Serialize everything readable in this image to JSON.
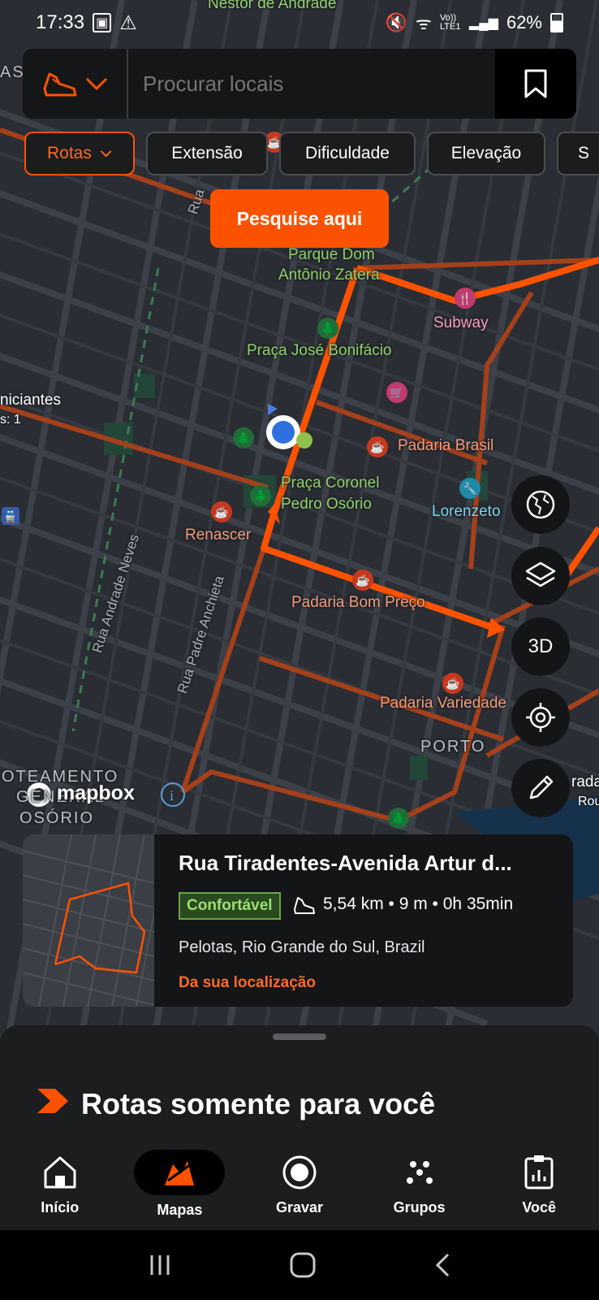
{
  "status_bar": {
    "time": "17:33",
    "battery": "62%",
    "network": "Vo)) LTE1"
  },
  "search": {
    "placeholder": "Procurar locais",
    "sport_icon": "running-shoe-icon"
  },
  "filters": [
    {
      "label": "Rotas",
      "active": true
    },
    {
      "label": "Extensão"
    },
    {
      "label": "Dificuldade"
    },
    {
      "label": "Elevação"
    },
    {
      "label": "S"
    }
  ],
  "search_here": "Pesquise aqui",
  "map": {
    "labels": {
      "nestor": "Nestor de Andrade",
      "parque": "Parque Dom",
      "parque2": "Antônio Zatera",
      "subway": "Subway",
      "praca_jose": "Praça José Bonifácio",
      "padaria_brasil": "Padaria Brasil",
      "praca_coronel": "Praça Coronel",
      "praca_coronel2": "Pedro Osório",
      "lorenzeto": "Lorenzeto",
      "renascer": "Renascer",
      "padaria_bom_preco": "Padaria Bom Preço",
      "padaria_variedade": "Padaria Variedade",
      "porto": "PORTO",
      "loteamento": "OTEAMENTO",
      "general": "GENERAL",
      "osorio": "OSÓRIO",
      "rua_andrade": "Rua Andrade Neves",
      "rua_padre": "Rua Padre Anchieta",
      "rua_top": "Rua",
      "iniciantes": "niciantes",
      "s1": "s: 1",
      "as": "AS",
      "rada": "rada",
      "rou": "Rou",
      "mapbox": "mapbox"
    },
    "accent_color": "#fc5200"
  },
  "map_controls": {
    "three_d": "3D"
  },
  "route_card": {
    "title": "Rua Tiradentes-Avenida Artur d...",
    "badge": "Confortável",
    "stats": "5,54 km • 9 m • 0h 35min",
    "location": "Pelotas, Rio Grande do Sul, Brazil",
    "from": "Da sua localização"
  },
  "sheet": {
    "title": "Rotas somente para você"
  },
  "bottom_nav": [
    {
      "label": "Início",
      "icon": "home-icon"
    },
    {
      "label": "Mapas",
      "icon": "maps-icon",
      "active": true
    },
    {
      "label": "Gravar",
      "icon": "record-icon"
    },
    {
      "label": "Grupos",
      "icon": "groups-icon"
    },
    {
      "label": "Você",
      "icon": "profile-icon"
    }
  ]
}
